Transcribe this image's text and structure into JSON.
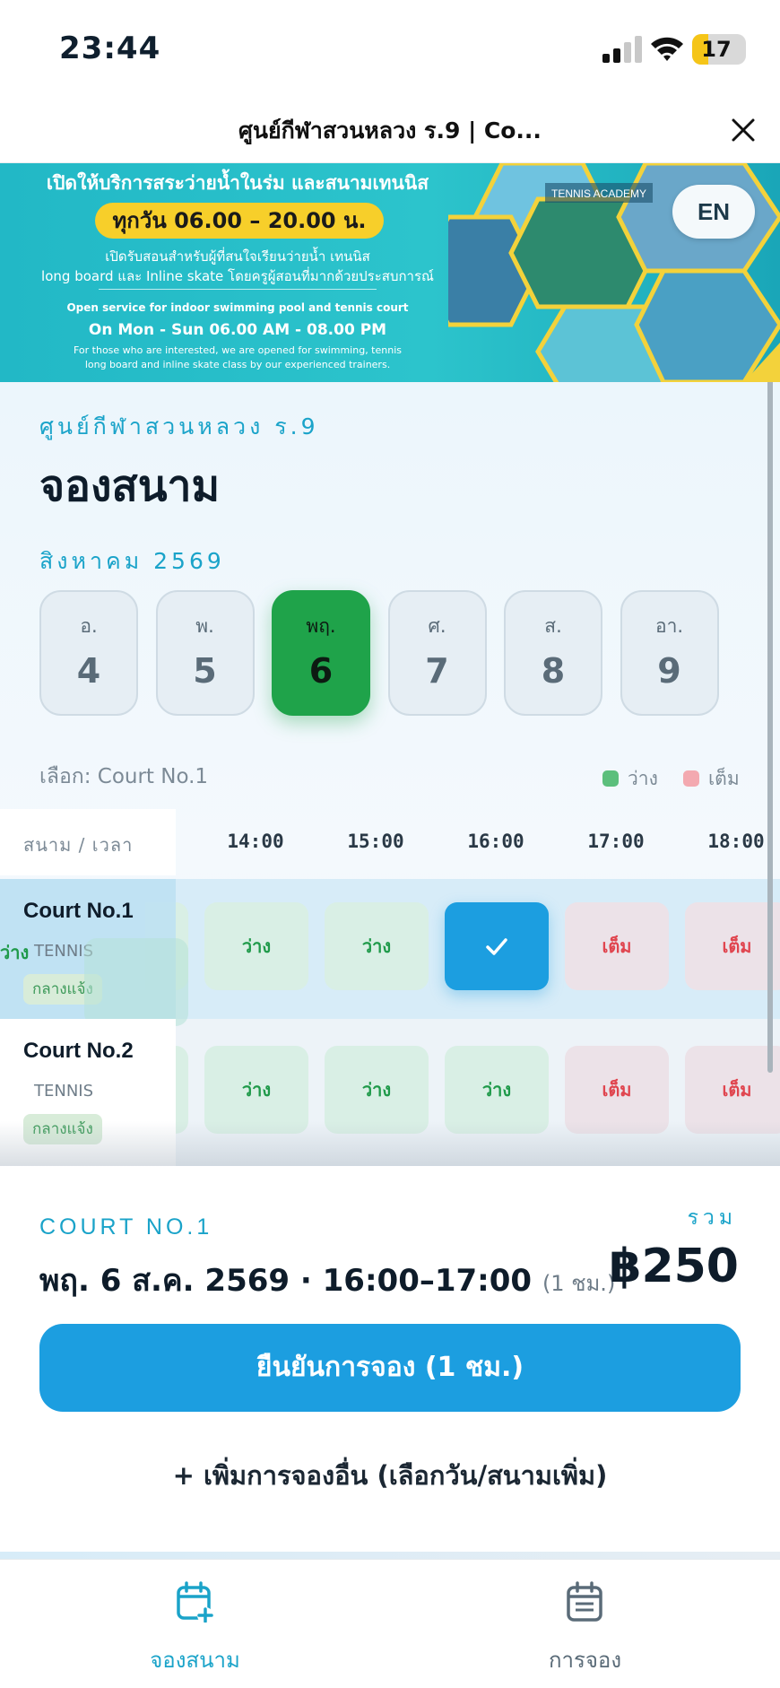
{
  "status_bar": {
    "time": "23:44",
    "battery": "17",
    "battery_level_pct": 17
  },
  "nav": {
    "title": "ศูนย์กีฬาสวนหลวง ร.9 | Co..."
  },
  "banner": {
    "line1": "เปิดให้บริการสระว่ายน้ำในร่ม และสนามเทนนิส",
    "hours_th": "ทุกวัน 06.00 – 20.00 น.",
    "line3": "เปิดรับสอนสำหรับผู้ที่สนใจเรียนว่ายน้ำ เทนนิส",
    "line4": "long board และ Inline skate โดยครูผู้สอนที่มากด้วยประสบการณ์",
    "line5": "Open service for indoor swimming pool and tennis court",
    "hours_en": "On Mon - Sun 06.00 AM - 08.00 PM",
    "line7": "For those who are interested, we are opened for swimming, tennis",
    "line8": "long board and inline skate class by our experienced trainers.",
    "photo_sign": "TENNIS ACADEMY",
    "lang_button": "EN"
  },
  "header": {
    "venue": "ศูนย์กีฬาสวนหลวง ร.9",
    "title": "จองสนาม",
    "month": "สิงหาคม 2569"
  },
  "days": [
    {
      "name": "อ.",
      "num": "4",
      "selected": false
    },
    {
      "name": "พ.",
      "num": "5",
      "selected": false
    },
    {
      "name": "พฤ.",
      "num": "6",
      "selected": true
    },
    {
      "name": "ศ.",
      "num": "7",
      "selected": false
    },
    {
      "name": "ส.",
      "num": "8",
      "selected": false
    },
    {
      "name": "อา.",
      "num": "9",
      "selected": false
    }
  ],
  "selection_label": "เลือก: Court No.1",
  "legend": {
    "free": "ว่าง",
    "full": "เต็ม",
    "free_color": "#5cbf7c",
    "full_color": "#f3a9b0"
  },
  "grid": {
    "corner_label": "สนาม / เวลา",
    "times": [
      "14:00",
      "15:00",
      "16:00",
      "17:00",
      "18:00"
    ],
    "courts": [
      {
        "name": "Court No.1",
        "type": "TENNIS",
        "zone": "กลางแจ้ง",
        "partial_prev": "ว่าง",
        "hidden_prev": "ว่าง",
        "slots": [
          {
            "state": "free",
            "label": "ว่าง"
          },
          {
            "state": "free",
            "label": "ว่าง"
          },
          {
            "state": "picked",
            "label": ""
          },
          {
            "state": "full",
            "label": "เต็ม"
          },
          {
            "state": "full",
            "label": "เต็ม"
          }
        ]
      },
      {
        "name": "Court No.2",
        "type": "TENNIS",
        "zone": "กลางแจ้ง",
        "slots": [
          {
            "state": "free",
            "label": "ว่าง"
          },
          {
            "state": "free",
            "label": "ว่าง"
          },
          {
            "state": "free",
            "label": "ว่าง"
          },
          {
            "state": "full",
            "label": "เต็ม"
          },
          {
            "state": "full",
            "label": "เต็ม"
          }
        ]
      }
    ]
  },
  "summary": {
    "court": "COURT NO.1",
    "when": "พฤ. 6 ส.ค. 2569 · 16:00–17:00",
    "duration": "(1 ชม.)",
    "total_label": "รวม",
    "price": "฿250",
    "confirm": "ยืนยันการจอง (1 ชม.)",
    "add_more": "+ เพิ่มการจองอื่น (เลือกวัน/สนามเพิ่ม)"
  },
  "tabs": [
    {
      "label": "จองสนาม",
      "icon": "calendar-plus-icon",
      "active": true
    },
    {
      "label": "การจอง",
      "icon": "calendar-list-icon",
      "active": false
    }
  ],
  "colors": {
    "accent": "#1c9ee0",
    "selected_day": "#1fa34a",
    "brand_text": "#1aa3c9"
  }
}
